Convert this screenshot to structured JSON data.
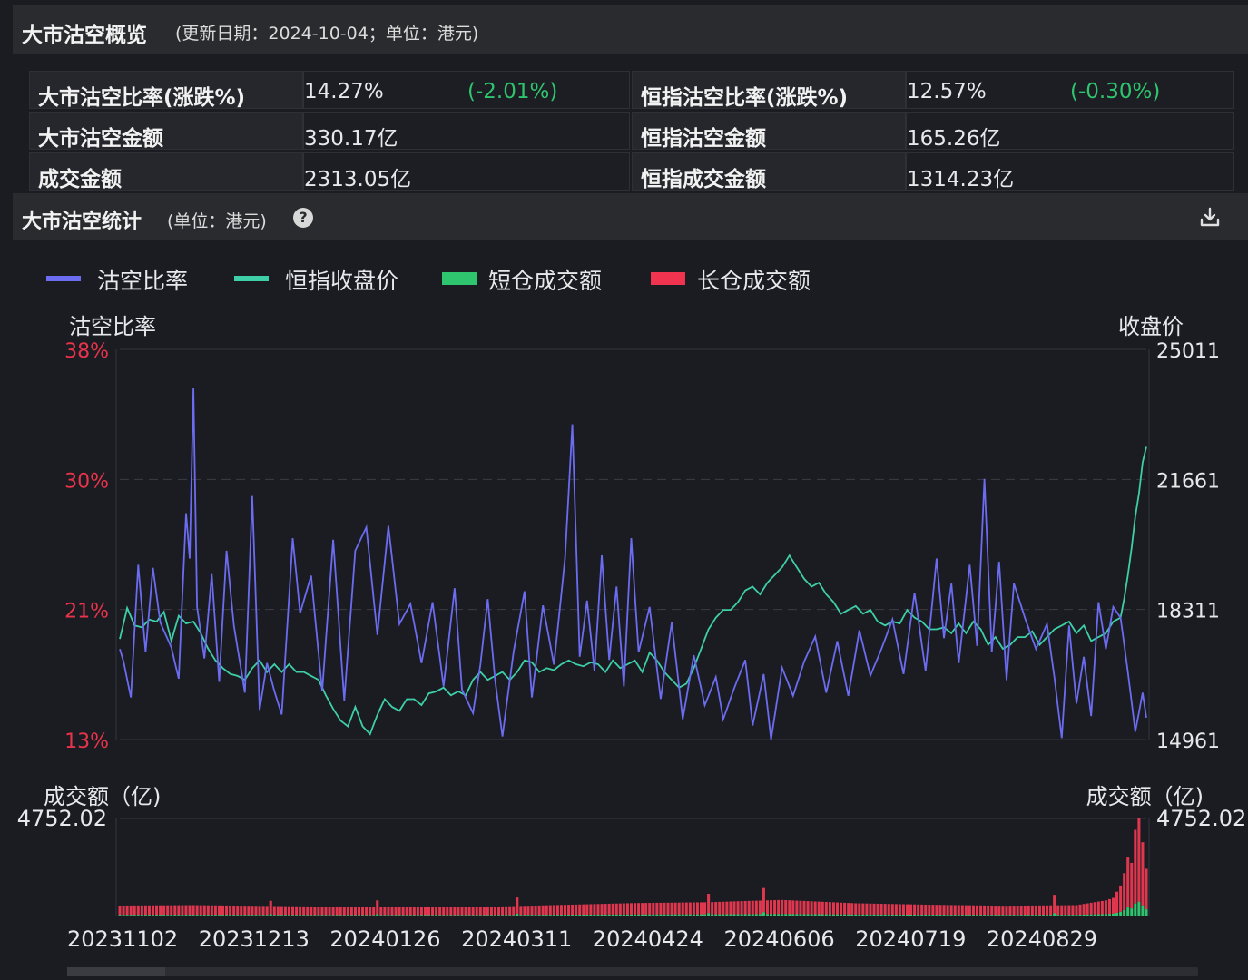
{
  "header": {
    "title": "大市沽空概览",
    "subtitle": "(更新日期：2024-10-04；单位：港元)"
  },
  "summary": {
    "market_short_ratio_label": "大市沽空比率(涨跌%)",
    "market_short_ratio_value": "14.27%",
    "market_short_ratio_change": "(-2.01%)",
    "market_short_amount_label": "大市沽空金额",
    "market_short_amount_value": "330.17亿",
    "turnover_label": "成交金额",
    "turnover_value": "2313.05亿",
    "hsi_short_ratio_label": "恒指沽空比率(涨跌%)",
    "hsi_short_ratio_value": "12.57%",
    "hsi_short_ratio_change": "(-0.30%)",
    "hsi_short_amount_label": "恒指沽空金额",
    "hsi_short_amount_value": "165.26亿",
    "hsi_turnover_label": "恒指成交金额",
    "hsi_turnover_value": "1314.23亿"
  },
  "section": {
    "title": "大市沽空统计",
    "subtitle": "(单位：港元)",
    "help_icon": "question-circle-icon",
    "download_icon": "download-icon"
  },
  "legend": [
    {
      "label": "沽空比率",
      "color": "#6b6cf0",
      "shape": "line"
    },
    {
      "label": "恒指收盘价",
      "color": "#3ecfa8",
      "shape": "line"
    },
    {
      "label": "短仓成交额",
      "color": "#2fc56e",
      "shape": "box"
    },
    {
      "label": "长仓成交额",
      "color": "#f0344f",
      "shape": "box"
    }
  ],
  "colors": {
    "short_ratio": "#6b6cf0",
    "hsi_close": "#3ecfa8",
    "short_volume": "#2fc56e",
    "long_volume": "#e0374f",
    "left_axis_text": "#e8334a",
    "axis_text": "#e8e8ea"
  },
  "chart_data": {
    "type": "line",
    "left_axis": {
      "label": "沽空比率",
      "ticks": [
        "38%",
        "30%",
        "21%",
        "13%"
      ],
      "range": [
        13,
        38
      ]
    },
    "right_axis": {
      "label": "收盘价",
      "ticks": [
        "25011",
        "21661",
        "18311",
        "14961"
      ],
      "range": [
        14961,
        25011
      ]
    },
    "volume_axis": {
      "left_label": "成交额（亿)",
      "right_label": "成交额（亿)",
      "max_label": "4752.02",
      "max": 4752.02
    },
    "x_labels": [
      "20231102",
      "20231213",
      "20240126",
      "20240311",
      "20240424",
      "20240606",
      "20240719",
      "20240829"
    ],
    "series_ratio_anchors": [
      [
        0,
        18.8
      ],
      [
        1,
        18.0
      ],
      [
        3,
        15.7
      ],
      [
        5,
        24.2
      ],
      [
        7,
        18.6
      ],
      [
        9,
        24.0
      ],
      [
        11,
        20.5
      ],
      [
        14,
        18.9
      ],
      [
        16,
        16.9
      ],
      [
        18,
        27.5
      ],
      [
        19,
        24.6
      ],
      [
        20,
        35.5
      ],
      [
        21,
        21.5
      ],
      [
        23,
        18.2
      ],
      [
        25,
        23.6
      ],
      [
        27,
        16.7
      ],
      [
        29,
        25.1
      ],
      [
        31,
        20.3
      ],
      [
        34,
        16.0
      ],
      [
        36,
        28.6
      ],
      [
        38,
        14.9
      ],
      [
        40,
        17.9
      ],
      [
        42,
        16.1
      ],
      [
        44,
        14.6
      ],
      [
        47,
        25.9
      ],
      [
        49,
        21.1
      ],
      [
        52,
        23.5
      ],
      [
        55,
        16.1
      ],
      [
        58,
        25.8
      ],
      [
        61,
        15.5
      ],
      [
        64,
        25.1
      ],
      [
        67,
        26.6
      ],
      [
        70,
        19.7
      ],
      [
        73,
        26.7
      ],
      [
        76,
        20.4
      ],
      [
        79,
        21.7
      ],
      [
        82,
        17.9
      ],
      [
        85,
        21.8
      ],
      [
        88,
        16.4
      ],
      [
        91,
        22.7
      ],
      [
        93,
        16.2
      ],
      [
        96,
        14.7
      ],
      [
        98,
        17.8
      ],
      [
        100,
        22.0
      ],
      [
        102,
        16.8
      ],
      [
        104,
        13.2
      ],
      [
        107,
        18.6
      ],
      [
        110,
        22.5
      ],
      [
        112,
        15.7
      ],
      [
        115,
        21.6
      ],
      [
        118,
        17.8
      ],
      [
        121,
        24.6
      ],
      [
        123,
        33.2
      ],
      [
        125,
        18.3
      ],
      [
        127,
        21.9
      ],
      [
        129,
        17.4
      ],
      [
        131,
        24.8
      ],
      [
        133,
        18.1
      ],
      [
        135,
        22.8
      ],
      [
        137,
        16.4
      ],
      [
        139,
        25.9
      ],
      [
        141,
        18.6
      ],
      [
        144,
        21.5
      ],
      [
        147,
        15.6
      ],
      [
        150,
        20.5
      ],
      [
        153,
        14.3
      ],
      [
        156,
        18.4
      ],
      [
        159,
        15.2
      ],
      [
        162,
        17.0
      ],
      [
        164,
        14.3
      ],
      [
        167,
        16.3
      ],
      [
        170,
        18.1
      ],
      [
        172,
        13.9
      ],
      [
        175,
        17.2
      ],
      [
        177,
        13.0
      ],
      [
        180,
        17.6
      ],
      [
        183,
        15.8
      ],
      [
        186,
        18.0
      ],
      [
        189,
        19.6
      ],
      [
        192,
        16.0
      ],
      [
        195,
        19.3
      ],
      [
        198,
        15.8
      ],
      [
        201,
        20.0
      ],
      [
        204,
        17.1
      ],
      [
        207,
        18.8
      ],
      [
        210,
        20.7
      ],
      [
        213,
        17.2
      ],
      [
        216,
        22.4
      ],
      [
        219,
        17.4
      ],
      [
        222,
        24.6
      ],
      [
        224,
        19.5
      ],
      [
        226,
        23.0
      ],
      [
        228,
        17.9
      ],
      [
        231,
        24.2
      ],
      [
        233,
        19.0
      ],
      [
        235,
        29.7
      ],
      [
        237,
        18.6
      ],
      [
        239,
        24.4
      ],
      [
        241,
        16.8
      ],
      [
        243,
        23.0
      ],
      [
        246,
        20.8
      ],
      [
        249,
        18.8
      ],
      [
        252,
        20.4
      ],
      [
        254,
        17.0
      ],
      [
        256,
        13.1
      ],
      [
        258,
        20.3
      ],
      [
        260,
        15.3
      ],
      [
        262,
        18.3
      ],
      [
        264,
        14.5
      ],
      [
        266,
        21.8
      ],
      [
        268,
        18.8
      ],
      [
        270,
        21.5
      ],
      [
        272,
        20.8
      ],
      [
        274,
        17.3
      ],
      [
        276,
        13.5
      ],
      [
        278,
        16.0
      ],
      [
        279,
        14.4
      ]
    ],
    "series_close_anchors": [
      [
        0,
        17550
      ],
      [
        2,
        18350
      ],
      [
        4,
        17900
      ],
      [
        6,
        17850
      ],
      [
        8,
        18050
      ],
      [
        10,
        18000
      ],
      [
        12,
        18250
      ],
      [
        14,
        17500
      ],
      [
        16,
        18150
      ],
      [
        18,
        17950
      ],
      [
        20,
        18000
      ],
      [
        22,
        17700
      ],
      [
        24,
        17300
      ],
      [
        26,
        17000
      ],
      [
        28,
        16800
      ],
      [
        30,
        16650
      ],
      [
        32,
        16600
      ],
      [
        34,
        16500
      ],
      [
        36,
        16800
      ],
      [
        38,
        17000
      ],
      [
        40,
        16700
      ],
      [
        42,
        16900
      ],
      [
        44,
        16700
      ],
      [
        46,
        16900
      ],
      [
        48,
        16700
      ],
      [
        50,
        16700
      ],
      [
        52,
        16600
      ],
      [
        54,
        16500
      ],
      [
        56,
        16100
      ],
      [
        58,
        15750
      ],
      [
        60,
        15450
      ],
      [
        62,
        15300
      ],
      [
        64,
        15800
      ],
      [
        66,
        15300
      ],
      [
        68,
        15100
      ],
      [
        70,
        15600
      ],
      [
        72,
        16000
      ],
      [
        74,
        15800
      ],
      [
        76,
        15700
      ],
      [
        78,
        16000
      ],
      [
        80,
        16000
      ],
      [
        82,
        15850
      ],
      [
        84,
        16150
      ],
      [
        86,
        16200
      ],
      [
        88,
        16300
      ],
      [
        90,
        16100
      ],
      [
        92,
        16200
      ],
      [
        94,
        16100
      ],
      [
        96,
        16500
      ],
      [
        98,
        16700
      ],
      [
        100,
        16500
      ],
      [
        102,
        16600
      ],
      [
        104,
        16700
      ],
      [
        106,
        16500
      ],
      [
        108,
        16700
      ],
      [
        110,
        17000
      ],
      [
        112,
        16950
      ],
      [
        114,
        16700
      ],
      [
        116,
        16800
      ],
      [
        118,
        16750
      ],
      [
        120,
        16900
      ],
      [
        122,
        17000
      ],
      [
        124,
        16900
      ],
      [
        126,
        16850
      ],
      [
        128,
        16950
      ],
      [
        130,
        16900
      ],
      [
        132,
        16700
      ],
      [
        134,
        17000
      ],
      [
        136,
        16800
      ],
      [
        138,
        16900
      ],
      [
        140,
        17000
      ],
      [
        142,
        16700
      ],
      [
        144,
        17200
      ],
      [
        146,
        17000
      ],
      [
        148,
        16700
      ],
      [
        150,
        16500
      ],
      [
        152,
        16300
      ],
      [
        154,
        16400
      ],
      [
        156,
        16800
      ],
      [
        158,
        17300
      ],
      [
        160,
        17800
      ],
      [
        162,
        18100
      ],
      [
        164,
        18300
      ],
      [
        166,
        18300
      ],
      [
        168,
        18500
      ],
      [
        170,
        18800
      ],
      [
        172,
        18900
      ],
      [
        174,
        18700
      ],
      [
        176,
        19000
      ],
      [
        178,
        19200
      ],
      [
        180,
        19400
      ],
      [
        182,
        19700
      ],
      [
        184,
        19400
      ],
      [
        186,
        19100
      ],
      [
        188,
        18900
      ],
      [
        190,
        19000
      ],
      [
        192,
        18700
      ],
      [
        194,
        18500
      ],
      [
        196,
        18200
      ],
      [
        198,
        18300
      ],
      [
        200,
        18400
      ],
      [
        202,
        18200
      ],
      [
        204,
        18300
      ],
      [
        206,
        18000
      ],
      [
        208,
        17900
      ],
      [
        210,
        18000
      ],
      [
        212,
        17950
      ],
      [
        214,
        18300
      ],
      [
        216,
        18100
      ],
      [
        218,
        18000
      ],
      [
        220,
        17800
      ],
      [
        222,
        17800
      ],
      [
        224,
        17850
      ],
      [
        226,
        17700
      ],
      [
        228,
        17950
      ],
      [
        230,
        17700
      ],
      [
        232,
        18000
      ],
      [
        234,
        17800
      ],
      [
        236,
        17400
      ],
      [
        238,
        17600
      ],
      [
        240,
        17300
      ],
      [
        242,
        17400
      ],
      [
        244,
        17600
      ],
      [
        246,
        17600
      ],
      [
        248,
        17750
      ],
      [
        250,
        17400
      ],
      [
        252,
        17600
      ],
      [
        254,
        17800
      ],
      [
        256,
        17900
      ],
      [
        258,
        18000
      ],
      [
        260,
        17700
      ],
      [
        262,
        17900
      ],
      [
        264,
        17500
      ],
      [
        266,
        17600
      ],
      [
        268,
        17700
      ],
      [
        270,
        18000
      ],
      [
        272,
        18100
      ],
      [
        273,
        18600
      ],
      [
        274,
        19200
      ],
      [
        275,
        19900
      ],
      [
        276,
        20700
      ],
      [
        277,
        21300
      ],
      [
        278,
        22100
      ],
      [
        279,
        22500
      ]
    ],
    "series_volume_anchors": [
      [
        0,
        530
      ],
      [
        20,
        550
      ],
      [
        40,
        510
      ],
      [
        60,
        470
      ],
      [
        80,
        480
      ],
      [
        100,
        470
      ],
      [
        120,
        560
      ],
      [
        140,
        650
      ],
      [
        160,
        690
      ],
      [
        170,
        750
      ],
      [
        180,
        800
      ],
      [
        190,
        720
      ],
      [
        200,
        640
      ],
      [
        220,
        570
      ],
      [
        240,
        520
      ],
      [
        260,
        550
      ],
      [
        268,
        780
      ],
      [
        270,
        900
      ],
      [
        272,
        1500
      ],
      [
        273,
        2100
      ],
      [
        274,
        2900
      ],
      [
        275,
        2600
      ],
      [
        276,
        4200
      ],
      [
        277,
        4752.02
      ],
      [
        278,
        3600
      ],
      [
        279,
        2313.05
      ]
    ],
    "volume_spikes": [
      [
        41,
        760
      ],
      [
        70,
        780
      ],
      [
        108,
        920
      ],
      [
        160,
        1100
      ],
      [
        175,
        1380
      ],
      [
        254,
        1050
      ]
    ],
    "short_fraction": 0.15
  }
}
